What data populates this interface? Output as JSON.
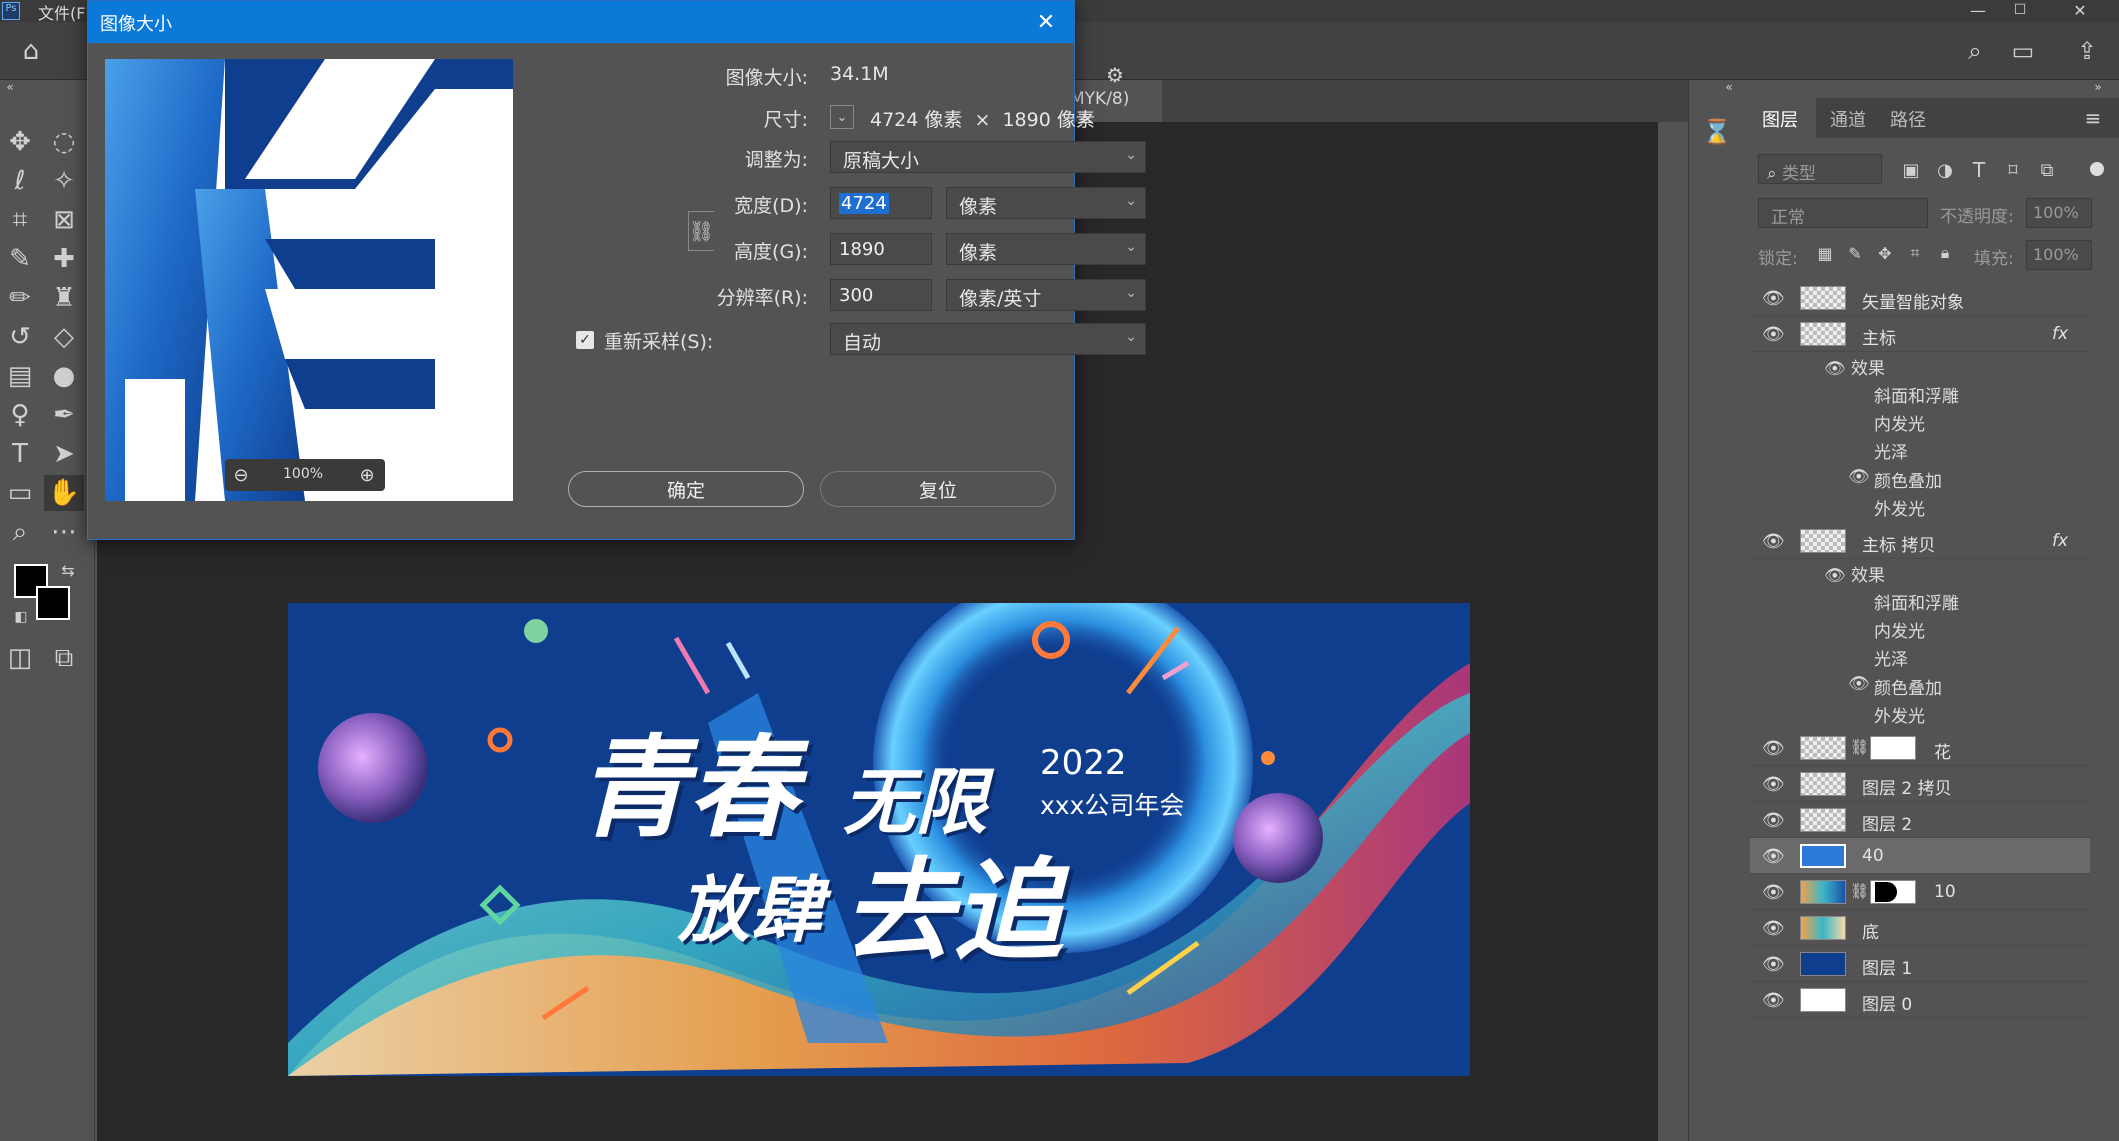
{
  "app": {
    "menu_file": "文件(F)"
  },
  "doc_tab": {
    "label": "MYK/8)",
    "close": "×"
  },
  "dialog": {
    "title": "图像大小",
    "image_size_label": "图像大小:",
    "image_size_value": "34.1M",
    "dimensions_label": "尺寸:",
    "dimensions_value": "4724 像素  ×  1890 像素",
    "fit_label": "调整为:",
    "fit_value": "原稿大小",
    "width_label": "宽度(D):",
    "width_value": "4724",
    "width_unit": "像素",
    "height_label": "高度(G):",
    "height_value": "1890",
    "height_unit": "像素",
    "resolution_label": "分辨率(R):",
    "resolution_value": "300",
    "resolution_unit": "像素/英寸",
    "resample_label": "重新采样(S):",
    "resample_checked": true,
    "resample_value": "自动",
    "zoom": "100%",
    "ok": "确定",
    "reset": "复位"
  },
  "banner": {
    "title_line1a": "青春",
    "title_line1b": "无限",
    "title_line2a": "放肆",
    "title_line2b": "去追",
    "year": "2022",
    "subtitle": "xxx公司年会"
  },
  "panel": {
    "tabs": [
      "图层",
      "通道",
      "路径"
    ],
    "filter_placeholder": "类型",
    "blend_mode": "正常",
    "opacity_label": "不透明度:",
    "opacity_value": "100%",
    "lock_label": "锁定:",
    "fill_label": "填充:",
    "fill_value": "100%",
    "fx": "fx",
    "layers": [
      {
        "name": "矢量智能对象"
      },
      {
        "name": "主标"
      },
      {
        "name": "主标 拷贝"
      },
      {
        "name": "花"
      },
      {
        "name": "图层 2 拷贝"
      },
      {
        "name": "图层 2"
      },
      {
        "name": "40"
      },
      {
        "name": "10"
      },
      {
        "name": "底"
      },
      {
        "name": "图层 1"
      },
      {
        "name": "图层 0"
      }
    ],
    "effects_label": "效果",
    "effects": [
      "斜面和浮雕",
      "内发光",
      "光泽",
      "颜色叠加",
      "外发光"
    ]
  },
  "colors": {
    "accent": "#0a79d8",
    "banner_bg": "#0f3e8f",
    "selected_layer": "#6a6a6a"
  }
}
